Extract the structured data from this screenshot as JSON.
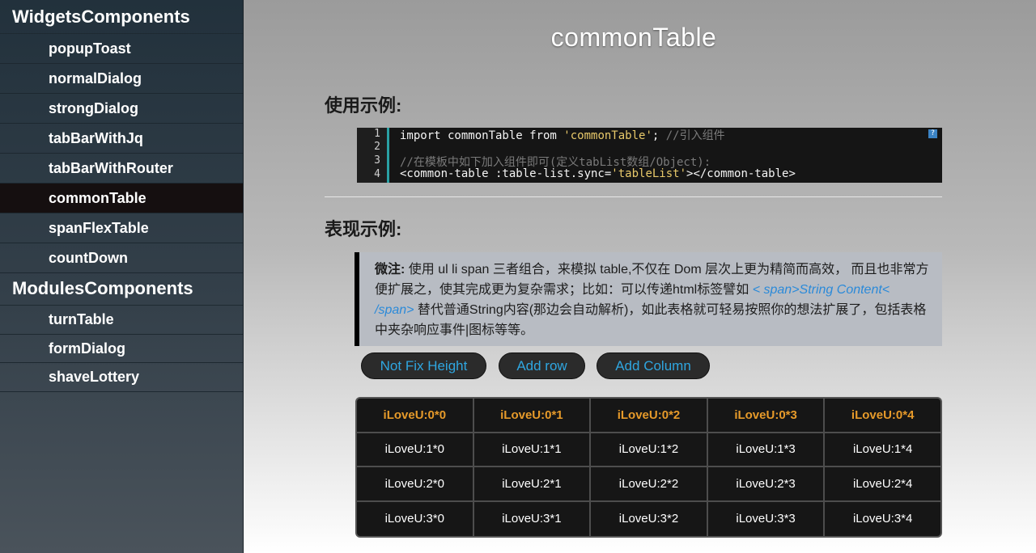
{
  "sidebar": {
    "groups": [
      {
        "title": "WidgetsComponents",
        "items": [
          "popupToast",
          "normalDialog",
          "strongDialog",
          "tabBarWithJq",
          "tabBarWithRouter",
          "commonTable",
          "spanFlexTable",
          "countDown"
        ]
      },
      {
        "title": "ModulesComponents",
        "items": [
          "turnTable",
          "formDialog",
          "shaveLottery"
        ]
      }
    ],
    "active_item": "commonTable"
  },
  "main": {
    "title": "commonTable",
    "usage_heading": "使用示例:",
    "demo_heading": "表现示例:",
    "code": {
      "line_numbers": [
        "1",
        "2",
        "3",
        "4"
      ],
      "line1": {
        "a": "import commonTable from ",
        "str": "'commonTable'",
        "b": "; ",
        "comment": "//引入组件"
      },
      "line3": {
        "comment": "//在模板中如下加入组件即可(定义tabList数组/Object):"
      },
      "line4": {
        "a": "<common-table :table-list.sync=",
        "str": "'tableList'",
        "b": "></common-table>"
      },
      "help_icon": "?"
    },
    "note": {
      "label": "微注:",
      "text1": " 使用 ul li span 三者组合，来模拟 table,不仅在 Dom 层次上更为精简而高效， 而且也非常方便扩展之，使其完成更为复杂需求；比如：可以传递html标签譬如 ",
      "link": "< span>String Content< /span>",
      "text2": " 替代普通String内容(那边会自动解析)，如此表格就可轻易按照你的想法扩展了，包括表格中夹杂响应事件|图标等等。"
    },
    "buttons": {
      "fix_height": "Not Fix Height",
      "add_row": "Add row",
      "add_column": "Add Column"
    },
    "table": {
      "header": [
        "iLoveU:0*0",
        "iLoveU:0*1",
        "iLoveU:0*2",
        "iLoveU:0*3",
        "iLoveU:0*4"
      ],
      "rows": [
        [
          "iLoveU:1*0",
          "iLoveU:1*1",
          "iLoveU:1*2",
          "iLoveU:1*3",
          "iLoveU:1*4"
        ],
        [
          "iLoveU:2*0",
          "iLoveU:2*1",
          "iLoveU:2*2",
          "iLoveU:2*3",
          "iLoveU:2*4"
        ],
        [
          "iLoveU:3*0",
          "iLoveU:3*1",
          "iLoveU:3*2",
          "iLoveU:3*3",
          "iLoveU:3*4"
        ]
      ]
    }
  },
  "colors": {
    "header_cell": "#e69a2a",
    "button_text": "#2fa6e0",
    "active_nav": "#150f10"
  }
}
